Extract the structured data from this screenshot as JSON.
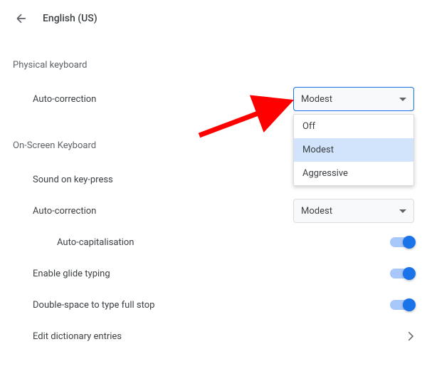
{
  "header": {
    "title": "English (US)"
  },
  "sections": {
    "physical": {
      "title": "Physical keyboard",
      "autocorrect_label": "Auto-correction",
      "autocorrect_value": "Modest"
    },
    "onscreen": {
      "title": "On-Screen Keyboard",
      "sound_label": "Sound on key-press",
      "autocorrect_label": "Auto-correction",
      "autocorrect_value": "Modest",
      "autocap_label": "Auto-capitalisation",
      "glide_label": "Enable glide typing",
      "doublespace_label": "Double-space to type full stop",
      "dictionary_label": "Edit dictionary entries"
    }
  },
  "dropdown": {
    "options": {
      "0": "Off",
      "1": "Modest",
      "2": "Aggressive"
    }
  },
  "annotation": {
    "arrow_color": "#ff0000"
  }
}
